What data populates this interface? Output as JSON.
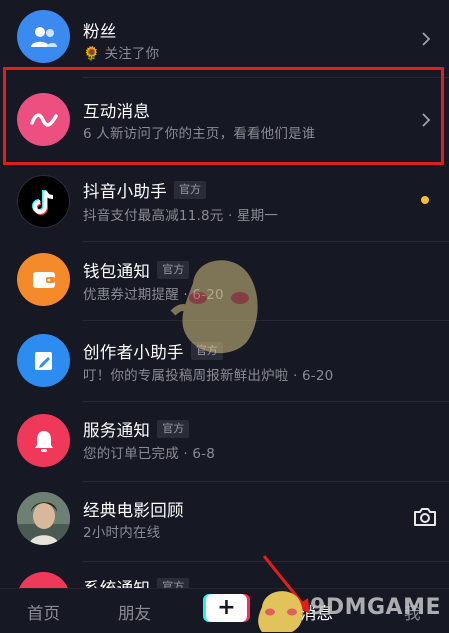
{
  "rows": [
    {
      "title": "粉丝",
      "sub_icon": "🌻",
      "subtitle": "关注了你",
      "avatar_color": "#3a8af0",
      "icon": "people-icon"
    },
    {
      "title": "互动消息",
      "subtitle": "6 人新访问了你的主页，看看他们是谁",
      "avatar_color": "#ec4f80",
      "icon": "interaction-wave-icon"
    },
    {
      "title": "抖音小助手",
      "badge": "官方",
      "subtitle": "抖音支付最高减11.8元 · 星期一",
      "avatar_color": "#000000",
      "icon": "tiktok-logo-icon",
      "unread_dot_color": "#f5c12b"
    },
    {
      "title": "钱包通知",
      "badge": "官方",
      "subtitle": "优惠券过期提醒 · 6-20",
      "avatar_color": "#f58a2b",
      "icon": "wallet-icon"
    },
    {
      "title": "创作者小助手",
      "badge": "官方",
      "subtitle": "叮！你的专属投稿周报新鲜出炉啦 · 6-20",
      "avatar_color": "#2d8cf0",
      "icon": "edit-icon"
    },
    {
      "title": "服务通知",
      "badge": "官方",
      "subtitle": "您的订单已完成 · 6-8",
      "avatar_color": "#f0385a",
      "icon": "bell-icon"
    },
    {
      "title": "经典电影回顾",
      "subtitle": "2小时内在线",
      "icon": "user-photo-avatar"
    },
    {
      "title": "系统通知",
      "badge": "官方",
      "avatar_color": "#f0385a"
    }
  ],
  "tabbar": {
    "home": "首页",
    "friends": "朋友",
    "plus": "+",
    "messages": "消息",
    "me": "我"
  },
  "watermark": "9DMGAME",
  "colors": {
    "highlight_border": "#e01e1e",
    "background": "#161823"
  }
}
